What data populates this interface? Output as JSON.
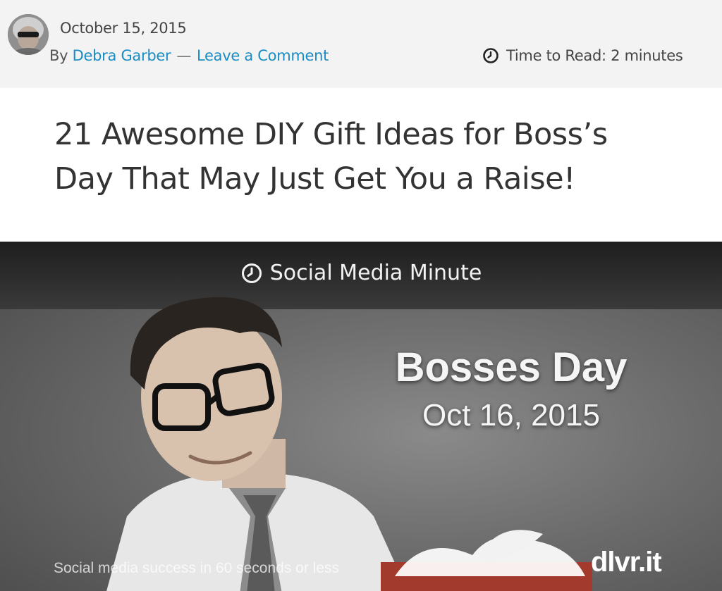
{
  "post": {
    "date": "October 15, 2015",
    "by_label": "By",
    "author": "Debra Garber",
    "separator": "—",
    "comment_link": "Leave a Comment",
    "read_time": "Time to Read: 2 minutes",
    "title": "21 Awesome DIY Gift Ideas for Boss’s Day That May Just Get You a Raise!"
  },
  "hero": {
    "caption": "Social Media Minute",
    "headline": "Bosses Day",
    "event_date": "Oct 16, 2015",
    "tagline": "Social media success in 60 seconds or less",
    "brand": "dlvr.it"
  },
  "icons": {
    "clock": "clock-icon",
    "avatar": "author-avatar"
  },
  "colors": {
    "link": "#1a8cc4",
    "meta_background": "#f3f3f3",
    "title_text": "#333333"
  }
}
